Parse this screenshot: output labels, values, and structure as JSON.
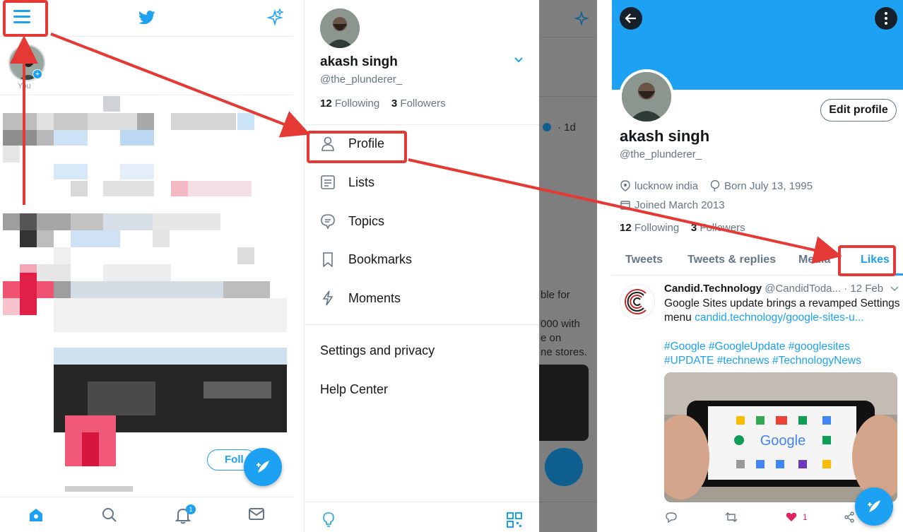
{
  "panel1": {
    "fleet_label": "You",
    "follow_label": "Foll",
    "notification_badge": "1",
    "icons": [
      "menu-icon",
      "twitter-bird-icon",
      "sparkle-icon",
      "home-icon",
      "search-icon",
      "bell-icon",
      "mail-icon",
      "compose-icon"
    ]
  },
  "drawer": {
    "name": "akash singh",
    "handle": "@the_plunderer_",
    "following_count": "12",
    "following_label": "Following",
    "followers_count": "3",
    "followers_label": "Followers",
    "menu": [
      {
        "label": "Profile",
        "icon": "person-icon"
      },
      {
        "label": "Lists",
        "icon": "list-icon"
      },
      {
        "label": "Topics",
        "icon": "topic-icon"
      },
      {
        "label": "Bookmarks",
        "icon": "bookmark-icon"
      },
      {
        "label": "Moments",
        "icon": "lightning-icon"
      }
    ],
    "settings": "Settings and privacy",
    "help": "Help Center",
    "overlay": {
      "time": "· 1d",
      "text1": "ble for",
      "text2": "000 with",
      "text3": "e on",
      "text4": "ne stores."
    }
  },
  "profile": {
    "name": "akash singh",
    "handle": "@the_plunderer_",
    "edit_label": "Edit profile",
    "location": "lucknow india",
    "born": "Born July 13, 1995",
    "joined": "Joined March 2013",
    "following_count": "12",
    "following_label": "Following",
    "followers_count": "3",
    "followers_label": "Followers",
    "tabs": [
      "Tweets",
      "Tweets & replies",
      "Media",
      "Likes"
    ],
    "active_tab": "Likes",
    "tweet": {
      "author": "Candid.Technology",
      "handle": "@CandidToda...",
      "time": "· 12 Feb",
      "text": "Google Sites update brings a revamped Settings menu ",
      "link": "candid.technology/google-sites-u...",
      "tags_line1": "#Google #GoogleUpdate #googlesites",
      "tags_line2": "#UPDATE #technews #TechnologyNews",
      "image_text": "Google",
      "like_count": "1"
    }
  },
  "colors": {
    "accent": "#1da1f2",
    "highlight": "#e53935",
    "dark": "#15202b"
  }
}
